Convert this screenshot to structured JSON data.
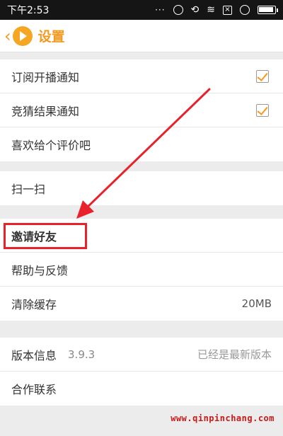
{
  "status_bar": {
    "time": "下午2:53",
    "icons": [
      "dots-icon",
      "lock-rotate-icon",
      "sync-icon",
      "wifi-icon",
      "notification-x-icon",
      "signal-off-icon",
      "battery-icon"
    ]
  },
  "header": {
    "back_icon": "chevron-left-icon",
    "logo_icon": "app-logo-icon",
    "title": "设置"
  },
  "notifications": {
    "items": [
      {
        "label": "订阅开播通知",
        "checked": true
      },
      {
        "label": "竞猜结果通知",
        "checked": true
      },
      {
        "label": "喜欢给个评价吧"
      }
    ]
  },
  "scan": {
    "label": "扫一扫"
  },
  "misc": {
    "invite_label": "邀请好友",
    "help_label": "帮助与反馈",
    "cache_label": "清除缓存",
    "cache_value": "20MB"
  },
  "about": {
    "version_label": "版本信息",
    "version_value": "3.9.3",
    "version_status": "已经是最新版本",
    "contact_label": "合作联系"
  },
  "annotation": {
    "highlight_color": "#e8212a",
    "accent_color": "#f39a1e"
  },
  "watermark": "www.qinpinchang.com"
}
